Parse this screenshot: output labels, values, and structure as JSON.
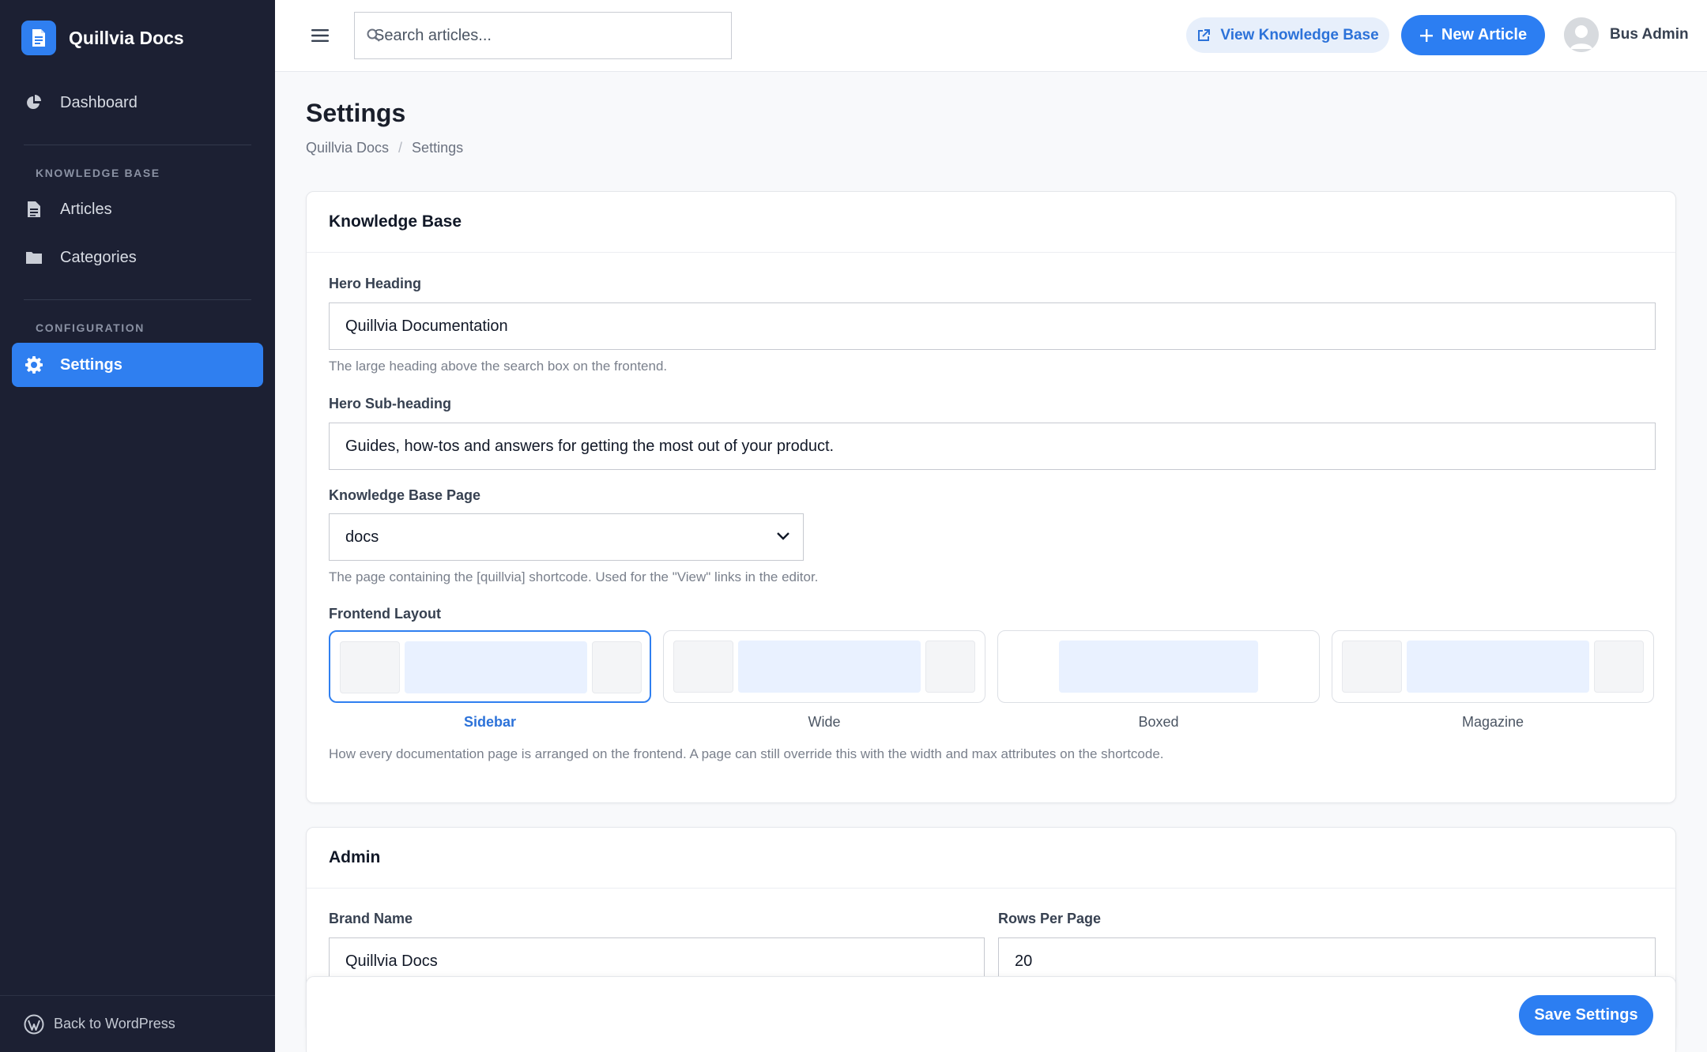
{
  "app": {
    "brand_name": "Quillvia Docs"
  },
  "sidebar": {
    "dashboard_label": "Dashboard",
    "section_kb": "KNOWLEDGE BASE",
    "articles_label": "Articles",
    "categories_label": "Categories",
    "section_config": "CONFIGURATION",
    "settings_label": "Settings",
    "footer_label": "Back to WordPress"
  },
  "topbar": {
    "search_placeholder": "Search articles...",
    "view_kb_label": "View Knowledge Base",
    "new_article_label": "New Article",
    "user_name": "Bus Admin"
  },
  "page": {
    "title": "Settings",
    "breadcrumb": [
      "Quillvia Docs",
      "Settings"
    ]
  },
  "kb_card": {
    "title": "Knowledge Base",
    "hero_heading_label": "Hero Heading",
    "hero_heading_value": "Quillvia Documentation",
    "hero_heading_help": "The large heading above the search box on the frontend.",
    "hero_sub_label": "Hero Sub-heading",
    "hero_sub_value": "Guides, how-tos and answers for getting the most out of your product.",
    "kb_page_label": "Knowledge Base Page",
    "kb_page_value": "docs",
    "kb_page_help": "The page containing the [quillvia] shortcode. Used for the \"View\" links in the editor.",
    "layout_label": "Frontend Layout",
    "layouts": [
      "Sidebar",
      "Wide",
      "Boxed",
      "Magazine"
    ],
    "selected_layout": "Sidebar",
    "layout_help": "How every documentation page is arranged on the frontend. A page can still override this with the width and max attributes on the shortcode."
  },
  "admin_card": {
    "title": "Admin",
    "brand_name_label": "Brand Name",
    "brand_name_value": "Quillvia Docs",
    "rows_label": "Rows Per Page",
    "rows_value": "20"
  },
  "save_bar": {
    "save_label": "Save Settings"
  },
  "colors": {
    "accent": "#2f7ff0",
    "sidebar_bg": "#1c2033"
  }
}
